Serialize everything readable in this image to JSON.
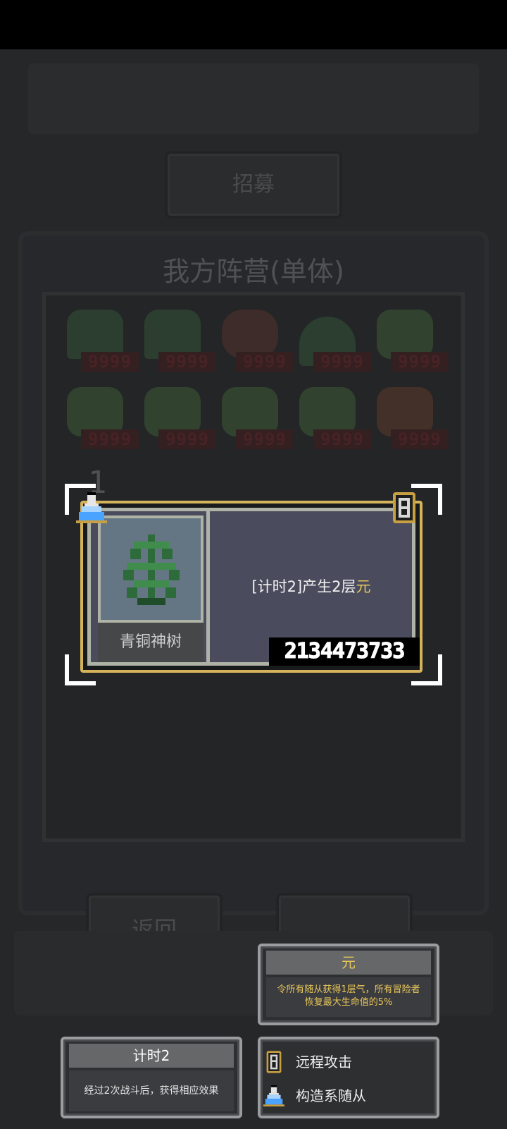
{
  "screen": {
    "title_bg": "我方阵营(单体)",
    "top_button": "招募",
    "back_button": "返回",
    "unit_hp_values": [
      "9999",
      "9999",
      "9999",
      "9999",
      "9999",
      "9999",
      "9999",
      "9999",
      "9999",
      "9999"
    ],
    "slot_number": "1"
  },
  "card": {
    "name": "青铜神树",
    "effect_prefix": "[计时2]产生2层",
    "effect_keyword": "元",
    "id_number": "2134473733",
    "icons": [
      "flask-icon",
      "bow-icon"
    ]
  },
  "tooltips": {
    "yuan": {
      "title": "元",
      "desc_line1": "令所有随从获得1层气，所有冒险者",
      "desc_line2": "恢复最大生命值的5%"
    },
    "timer": {
      "title": "计时2",
      "desc": "经过2次战斗后，获得相应效果"
    },
    "traits": {
      "ranged": "远程攻击",
      "construct": "构造系随从"
    }
  },
  "colors": {
    "keyword_gold": "#e8c65a",
    "frame_gold": "#d4b35a",
    "hp_red": "#a0181c",
    "background": "#262729"
  }
}
